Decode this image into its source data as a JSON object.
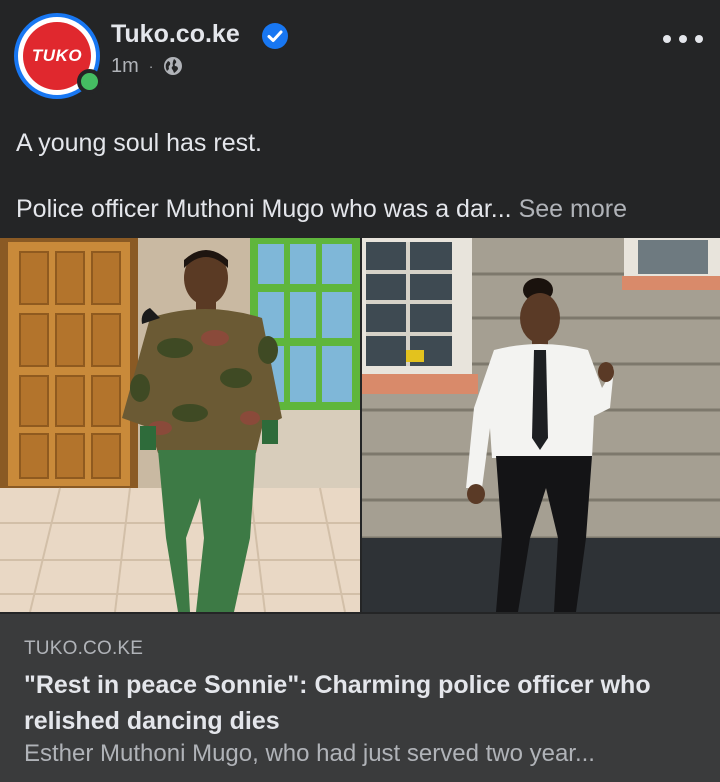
{
  "post": {
    "page_name": "Tuko.co.ke",
    "avatar_text": "TUKO",
    "time": "1m",
    "separator": "·",
    "privacy_icon": "globe-icon",
    "verified_icon": "verified-badge-icon",
    "more_icon": "more-options-icon",
    "caption_line1": "A young soul has rest.",
    "caption_line2": "Police officer Muthoni Mugo who was a dar...",
    "see_more": "See more"
  },
  "link_preview": {
    "domain": "TUKO.CO.KE",
    "title": "\"Rest in peace Sonnie\": Charming police officer who relished dancing dies",
    "description": "Esther Muthoni Mugo, who had just served two year..."
  },
  "colors": {
    "background": "#242526",
    "card": "#3a3b3c",
    "brand_red": "#e0282e",
    "verified_blue": "#1877f2",
    "online_green": "#45bd62"
  }
}
